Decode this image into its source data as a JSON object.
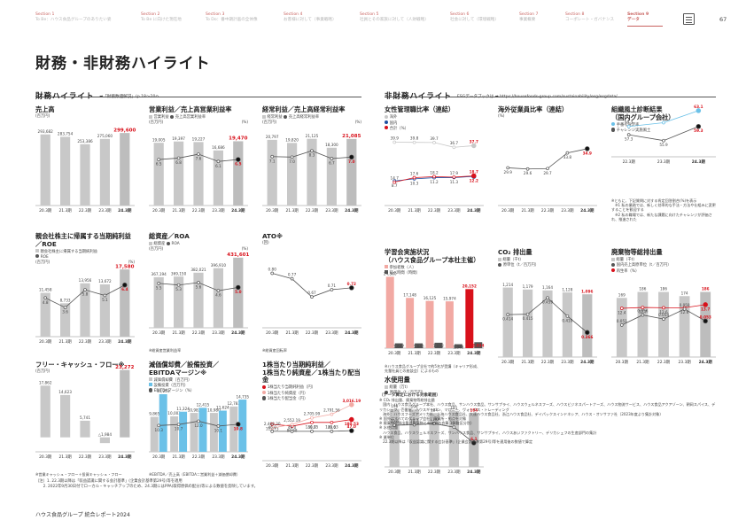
{
  "nav": [
    {
      "num": "Section 1",
      "text": "To Be：ハウス食品グループのありたい姿"
    },
    {
      "num": "Section 2",
      "text": "To Be に向けた現在地"
    },
    {
      "num": "Section 3",
      "text": "To Do：番中期計画の全体像"
    },
    {
      "num": "Section 4",
      "text": "お客様に対して（事業戦略）"
    },
    {
      "num": "Section 5",
      "text": "社員とその家族に対して（人財戦略）"
    },
    {
      "num": "Section 6",
      "text": "社会に対して（環境戦略）"
    },
    {
      "num": "Section 7",
      "text": "事業概要"
    },
    {
      "num": "Section 8",
      "text": "コーポレート・ガバナンス"
    },
    {
      "num": "Section 9",
      "text": "データ"
    }
  ],
  "page_number": "67",
  "page_title": "財務・非財務ハイライト",
  "headers": {
    "financial": "財務ハイライト",
    "financial_link": "➡「財務数値解説」(p.18～20へ",
    "nonfinancial": "非財務ハイライト",
    "nonfinancial_link": "ESGデータブックは ➡ https://housefoods-group.com/sustainability/esg/esgdata/"
  },
  "colors": {
    "gray": "#c8c8c8",
    "red": "#d8111b",
    "pink": "#f2a9a3",
    "blue": "#6bc1e8",
    "navy": "#1e4fa0",
    "lightblue": "#bfe2f4",
    "dark": "#555555"
  },
  "chart_data": [
    {
      "id": "sales",
      "type": "bar",
      "title": "売上高",
      "legend": [],
      "unit_left": "(百万円)",
      "unit_right": "",
      "categories": [
        "20.3期",
        "21.3期",
        "22.3期",
        "23.3期",
        "24.3期"
      ],
      "series": [
        {
          "name": "",
          "values": [
            293682,
            283754,
            253386,
            275060,
            299600
          ],
          "labels": [
            "293,682",
            "283,754",
            "253,386",
            "275,060",
            "299,600"
          ]
        }
      ]
    },
    {
      "id": "op",
      "type": "bar",
      "title": "営業利益／売上高営業利益率",
      "legend": [
        "営業利益",
        "売上高営業利益率"
      ],
      "unit_left": "(百万円)",
      "unit_right": "(%)",
      "categories": [
        "20.3期",
        "21.3期",
        "22.3期",
        "23.3期",
        "24.3期"
      ],
      "series": [
        {
          "name": "営業利益",
          "values": [
            19005,
            19397,
            19227,
            16686,
            19470
          ],
          "labels": [
            "19,005",
            "19,397",
            "19,227",
            "16,686",
            "19,470"
          ]
        },
        {
          "name": "売上高営業利益率",
          "values": [
            6.5,
            6.8,
            7.6,
            6.1,
            6.5
          ],
          "labels": [
            "6.5",
            "6.8",
            "7.6",
            "6.1",
            "6.5"
          ]
        }
      ]
    },
    {
      "id": "ord",
      "type": "bar",
      "title": "経常利益／売上高経常利益率",
      "legend": [
        "経常利益",
        "売上高経常利益率"
      ],
      "unit_left": "(百万円)",
      "unit_right": "(%)",
      "categories": [
        "20.3期",
        "21.3期",
        "22.3期",
        "23.3期",
        "24.3期"
      ],
      "series": [
        {
          "name": "経常利益",
          "values": [
            20797,
            19820,
            21125,
            18300,
            21085
          ],
          "labels": [
            "20,797",
            "19,820",
            "21,125",
            "18,300",
            "21,085"
          ]
        },
        {
          "name": "売上高経常利益率",
          "values": [
            7.1,
            7.0,
            8.3,
            6.7,
            7.0
          ],
          "labels": [
            "7.1",
            "7.0",
            "8.3",
            "6.7",
            "7.0"
          ]
        }
      ]
    },
    {
      "id": "netinc",
      "type": "bar",
      "title": "親会社株主に帰属する当期純利益／ROE",
      "legend": [
        "親会社株主に帰属する当期純利益",
        "ROE"
      ],
      "unit_left": "(百万円)",
      "unit_right": "(%)",
      "categories": [
        "20.3期",
        "21.3期",
        "22.3期",
        "23.3期",
        "24.3期"
      ],
      "series": [
        {
          "name": "親会社株主に帰属する当期純利益",
          "values": [
            11458,
            8733,
            13956,
            13672,
            17580
          ],
          "labels": [
            "11,458",
            "8,733",
            "13,956",
            "13,672",
            "17,580"
          ]
        },
        {
          "name": "ROE",
          "values": [
            4.8,
            3.6,
            5.8,
            5.1,
            6.4
          ],
          "labels": [
            "4.8",
            "3.6",
            "5.8",
            "5.1",
            "6.4"
          ]
        }
      ]
    },
    {
      "id": "assets",
      "type": "bar",
      "title": "総資産／ROA",
      "legend": [
        "総資産",
        "ROA"
      ],
      "unit_left": "(百万円)",
      "unit_right": "(%)",
      "categories": [
        "20.3期",
        "21.3期",
        "22.3期",
        "23.3期",
        "24.3期"
      ],
      "series": [
        {
          "name": "総資産",
          "values": [
            367194,
            369150,
            382021,
            396910,
            431601
          ],
          "labels": [
            "367,194",
            "369,150",
            "382,021",
            "396,910",
            "431,601"
          ]
        },
        {
          "name": "ROA",
          "values": [
            5.5,
            5.3,
            5.6,
            4.6,
            5.0
          ],
          "labels": [
            "5.5",
            "5.3",
            "5.6",
            "4.6",
            "5.0"
          ]
        }
      ],
      "note": "※総資産営業利益率"
    },
    {
      "id": "ato",
      "type": "line",
      "title": "ATO※",
      "legend": [],
      "unit_left": "(回)",
      "unit_right": "",
      "categories": [
        "20.3期",
        "21.3期",
        "22.3期",
        "23.3期",
        "24.3期"
      ],
      "series": [
        {
          "name": "",
          "values": [
            0.8,
            0.77,
            0.67,
            0.71,
            0.72
          ],
          "labels": [
            "0.80",
            "0.77",
            "0.67",
            "0.71",
            "0.72"
          ]
        }
      ],
      "note": "※総資産回転率"
    },
    {
      "id": "fcf",
      "type": "bar",
      "title": "フリー・キャッシュ・フロー※",
      "legend": [],
      "unit_left": "(百万円)",
      "unit_right": "",
      "categories": [
        "20.3期",
        "21.3期",
        "22.3期",
        "23.3期",
        "24.3期"
      ],
      "series": [
        {
          "name": "",
          "values": [
            17862,
            14623,
            5741,
            -1984,
            23272
          ],
          "labels": [
            "17,862",
            "14,623",
            "5,741",
            "△1,984",
            "23,272"
          ]
        }
      ],
      "note": "※営業キャッシュ・フロー＋投資キャッシュ・フロー"
    },
    {
      "id": "ebitda",
      "type": "bar",
      "title": "減価償却費／設備投資／\nEBITDAマージン※",
      "legend": [
        "減価償却費（百万円）",
        "設備投資（百万円）",
        "EBITDAマージン（%）"
      ],
      "unit_left": "",
      "unit_right": "",
      "categories": [
        "20.3期",
        "21.3期",
        "22.3期",
        "23.3期",
        "24.3期"
      ],
      "series": [
        {
          "name": "減価償却費（百万円）",
          "values": [
            9865,
            10003,
            10983,
            10980,
            12783
          ],
          "labels": [
            "9,865",
            "10,003",
            "10,983",
            "10,980",
            "12,783"
          ]
        },
        {
          "name": "設備投資（百万円）",
          "values": [
            16253,
            11324,
            12415,
            11624,
            14735
          ],
          "labels": [
            "16,253",
            "11,324",
            "12,415",
            "11,624",
            "14,735"
          ]
        },
        {
          "name": "EBITDAマージン（%）",
          "values": [
            10.3,
            10.7,
            12.0,
            10.1,
            10.8
          ],
          "labels": [
            "10.3",
            "10.7",
            "12.0",
            "10.1",
            "10.8"
          ]
        }
      ],
      "note": "※EBITDA／売上高（EBITDA＝営業利益＋減価償却費）"
    },
    {
      "id": "eps",
      "type": "line",
      "title": "1株当たり当期純利益／\n1株当たり純資産／1株当たり配当金",
      "legend": [
        "1株当たり当期純利益（円）",
        "1株当たり純資産（円）",
        "1株当たり配当金（円）"
      ],
      "unit_left": "",
      "unit_right": "",
      "categories": [
        "20.3期",
        "21.3期",
        "22.3期",
        "23.3期",
        "24.3期"
      ],
      "series": [
        {
          "name": "1株当たり当期純利益（円）",
          "values": [
            113.73,
            86.68,
            139.75,
            139.63,
            180.53
          ],
          "labels": [
            "113.73",
            "86.68",
            "139.75",
            "139.63",
            "180.53"
          ]
        },
        {
          "name": "1株当たり純資産（円）",
          "values": [
            2468.3,
            2552.19,
            2705.99,
            2791.56,
            3016.19
          ],
          "labels": [
            "2,468.30",
            "2,552.19",
            "2,705.99",
            "2,791.56",
            "3,016.19"
          ]
        },
        {
          "name": "1株当たり配当金（円）",
          "values": [
            46.0,
            46.0,
            46.0,
            46.0,
            47.0
          ],
          "labels": [
            "46.0",
            "46.0",
            "46.0",
            "46.0",
            "47.0"
          ]
        }
      ]
    },
    {
      "id": "women",
      "type": "line",
      "title": "女性管理職比率（連結）",
      "legend": [
        "海外",
        "国内",
        "合計（%）"
      ],
      "unit_left": "",
      "unit_right": "",
      "categories": [
        "20.3期",
        "21.3期",
        "22.3期",
        "23.3期",
        "24.3期"
      ],
      "series": [
        {
          "name": "海外",
          "values": [
            39.9,
            39.8,
            39.7,
            36.7,
            37.7
          ],
          "labels": [
            "39.9",
            "39.8",
            "39.7",
            "36.7",
            "37.7"
          ]
        },
        {
          "name": "国内",
          "values": [
            8.7,
            10.3,
            11.2,
            11.3,
            12.2
          ],
          "labels": [
            "8.7",
            "10.3",
            "11.2",
            "11.3",
            "12.2"
          ]
        },
        {
          "name": "合計（%）",
          "values": [
            14.7,
            17.6,
            18.2,
            17.9,
            18.7
          ],
          "labels": [
            "14.7",
            "17.6",
            "18.2",
            "17.9",
            "18.7"
          ]
        }
      ]
    },
    {
      "id": "overseas",
      "type": "line",
      "title": "海外従業員比率（連結）",
      "legend": [],
      "unit_left": "(%)",
      "unit_right": "",
      "categories": [
        "20.3期",
        "21.3期",
        "22.3期",
        "23.3期",
        "24.3期"
      ],
      "series": [
        {
          "name": "",
          "values": [
            29.9,
            29.6,
            29.7,
            33.8,
            34.9
          ],
          "labels": [
            "29.9",
            "29.6",
            "29.7",
            "33.8",
            "34.9"
          ]
        }
      ]
    },
    {
      "id": "culture",
      "type": "line",
      "title": "組織風土診断結果\n（国内グループ会社）",
      "legend": [
        "手番号肯定率",
        "チャレンジ実施風土"
      ],
      "unit_left": "",
      "unit_right": "",
      "categories": [
        "22.3期",
        "23.3期",
        "24.3期"
      ],
      "series": [
        {
          "name": "手番号肯定率",
          "values": [
            59.3,
            60.2,
            63.1
          ],
          "labels": [
            "59.3",
            "60.2",
            "63.1"
          ]
        },
        {
          "name": "チャレンジ実施風土",
          "values": [
            57.3,
            55.9,
            59.3
          ],
          "labels": [
            "57.3",
            "55.9",
            "59.3"
          ]
        }
      ],
      "note": "※ともに、下記質問に対する肯定回答割合(%)を表示\n　※1 私の業務では、新しく効率的な手法・方法や仕組みに変更することを歓迎する\n　※2 私の職場では、新たな課題に向けたチャレンジが評価され、推進された"
    },
    {
      "id": "learning",
      "type": "bar",
      "title": "学習会実施状況\n（ハウス食品グループ本社主催）",
      "legend": [
        "参加者数（人）",
        "延べ時間（時間）"
      ],
      "unit_left": "",
      "unit_right": "",
      "categories": [
        "20.3期",
        "21.3期",
        "22.3期",
        "23.3期",
        "24.3期"
      ],
      "series": [
        {
          "name": "参加者数（人）",
          "values": [
            24360,
            17148,
            16125,
            15974,
            20152
          ],
          "labels": [
            "24,360",
            "17,148",
            "16,125",
            "15,974",
            "20,152"
          ]
        },
        {
          "name": "延べ時間（時間）",
          "values": [
            1647,
            1640,
            1852,
            1348,
            2034
          ],
          "labels": [
            "1,647",
            "1,640",
            "1,852",
            "1,348",
            "2,034"
          ]
        }
      ],
      "note": "※ハウス食品グループ全社で約5名が受講（キャリア形成、先輩社員との座談会）によるもの"
    },
    {
      "id": "co2",
      "type": "bar",
      "title": "CO₂ 排出量",
      "legend": [
        "総量（千t）",
        "原単位（t／百万円）"
      ],
      "unit_left": "",
      "unit_right": "",
      "categories": [
        "20.3期",
        "21.3期",
        "22.3期",
        "23.3期",
        "24.3期"
      ],
      "series": [
        {
          "name": "総量（千t）",
          "values": [
            1214,
            1179,
            1164,
            1128,
            1096
          ],
          "labels": [
            "1,214",
            "1,179",
            "1,164",
            "1,128",
            "1,096"
          ]
        },
        {
          "name": "原単位（t／百万円）",
          "values": [
            0.414,
            0.415,
            0.459,
            0.41,
            0.366
          ],
          "labels": [
            "0.414",
            "0.415",
            "0.459",
            "0.410",
            "0.366"
          ]
        }
      ]
    },
    {
      "id": "waste",
      "type": "bar",
      "title": "廃棄物等総排出量",
      "legend": [
        "総量（千t）",
        "国内売上高原単位（t／百万円）",
        "再生率（%）"
      ],
      "unit_left": "",
      "unit_right": "",
      "categories": [
        "20.3期",
        "21.3期",
        "22.3期",
        "23.3期",
        "24.3期"
      ],
      "series": [
        {
          "name": "総量（千t）",
          "values": [
            169,
            186,
            186,
            174,
            186
          ],
          "labels": [
            "169",
            "186",
            "186",
            "174",
            "186"
          ]
        },
        {
          "name": "再生率（%）",
          "values": [
            12.4,
            12.7,
            12.6,
            12.6,
            13.7
          ],
          "labels": [
            "12.4",
            "12.7",
            "12.6",
            "12.6",
            "13.7"
          ]
        },
        {
          "name": "国内売上高原単位（t／百万円）",
          "values": [
            0.051,
            0.056,
            0.054,
            0.059,
            0.053
          ],
          "labels": [
            "0.051",
            "0.056",
            "0.054",
            "0.059",
            "0.053"
          ]
        }
      ]
    },
    {
      "id": "water",
      "type": "bar",
      "title": "水使用量",
      "legend": [
        "総量（万t）",
        "原単位（t／百万円）"
      ],
      "unit_left": "",
      "unit_right": "",
      "categories": [
        "20.3期",
        "21.3期",
        "22.3期",
        "23.3期",
        "24.3期"
      ],
      "series": [
        {
          "name": "総量（万t）",
          "values": [
            198,
            196,
            184,
            191,
            184
          ],
          "labels": [
            "198",
            "196",
            "184",
            "191",
            "184"
          ]
        },
        {
          "name": "原単位（t／百万円）",
          "values": [
            10.6,
            10.7,
            11.0,
            10.1,
            6.1
          ],
          "labels": [
            "10.6",
            "10.7",
            "11.0",
            "10.1",
            "6.1"
          ]
        }
      ]
    }
  ],
  "data_notes": {
    "title": "（データ算定における対象範囲）",
    "body": "※ CO₂ 排出量、廃棄物等総排出量\n　国内：ハウス食品グループ本社、ハウス食品、サンハウス食品、サンサプライ、ハウスウェルネスフーズ、ハウスビジネスパートナーズ、ハウス物流サービス、ハウス食品アクアゾーン、朝岡スパイス、デリカシェフ、壱番屋、ハウスギャバン、マロニー、ヴォークス・トレーディング\n　海外：ハウスフーズアメリカ社、上海ハウス食品社、大連ハウス食品社、浙江ハウス食品社、デイパックスインドネシア、ハウス・オソサファ社（2023年度より集計対象）\n※ 国外はすべてのグループ会社：事業所・拠点を対象\n※ 廃棄物等排出量は廃棄物と有価物の合算（調査区分別）\n※ 水使用量\n　ハウス食品、ハウスウェルネスフーズ、サンハウス食品、サンサプライ、ハウスあいファクトリー、デリカシェフの生産部門の集計\n※ 業単位\n　22.3期以降は「収益認識に関する会計基準」(企業会計基準第29号)等を適用後の数値で算定"
  },
  "footer_notes": [
    "（注）1. 22.3期以降は「収益認識に関する会計基準」(企業会計基準第29号)等を適用",
    "　　2. 2022年9月30日付でローカル・キャッチアップのため、24.3期にはPPA(取得原価の配分)等による数値を反映しています。"
  ],
  "report_title": "ハウス食品グループ 統合レポート2024"
}
